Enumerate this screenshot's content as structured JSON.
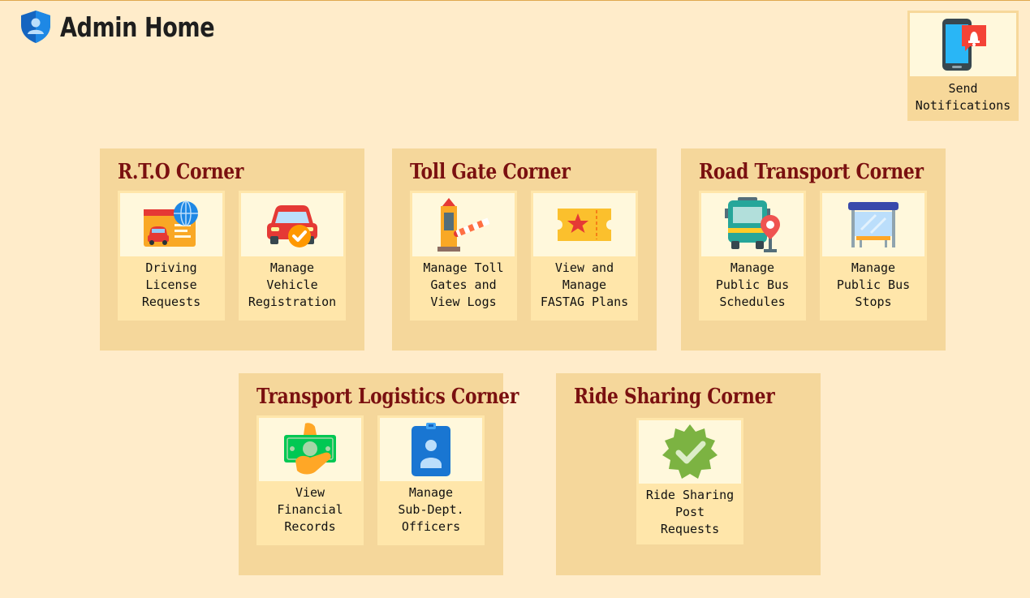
{
  "header": {
    "title": "Admin Home",
    "logo_icon": "shield-user-icon"
  },
  "notifications": {
    "label": "Send\nNotifications",
    "icon": "phone-bell-icon"
  },
  "corners": [
    {
      "title": "R.T.O Corner",
      "items": [
        {
          "label": "Driving\nLicense\nRequests",
          "icon": "license-card-icon"
        },
        {
          "label": "Manage\nVehicle\nRegistration",
          "icon": "car-check-icon"
        }
      ]
    },
    {
      "title": "Toll Gate Corner",
      "items": [
        {
          "label": "Manage Toll\nGates and\nView Logs",
          "icon": "toll-barrier-icon"
        },
        {
          "label": "View and\nManage\nFASTAG Plans",
          "icon": "ticket-star-icon"
        }
      ]
    },
    {
      "title": "Road Transport Corner",
      "items": [
        {
          "label": "Manage\nPublic Bus\nSchedules",
          "icon": "bus-pin-icon"
        },
        {
          "label": "Manage\nPublic Bus\nStops",
          "icon": "bus-stop-icon"
        }
      ]
    },
    {
      "title": "Transport Logistics Corner",
      "items": [
        {
          "label": "View\nFinancial\nRecords",
          "icon": "money-hand-icon"
        },
        {
          "label": "Manage\nSub-Dept.\nOfficers",
          "icon": "id-badge-icon"
        }
      ]
    },
    {
      "title": "Ride Sharing Corner",
      "items": [
        {
          "label": "Ride Sharing\nPost\nRequests",
          "icon": "verified-badge-icon"
        }
      ]
    }
  ],
  "colors": {
    "background": "#ffecca",
    "panel": "#f5d79b",
    "card": "#ffe6aa",
    "icon_box": "#fff8dc",
    "corner_title": "#7a1010"
  }
}
